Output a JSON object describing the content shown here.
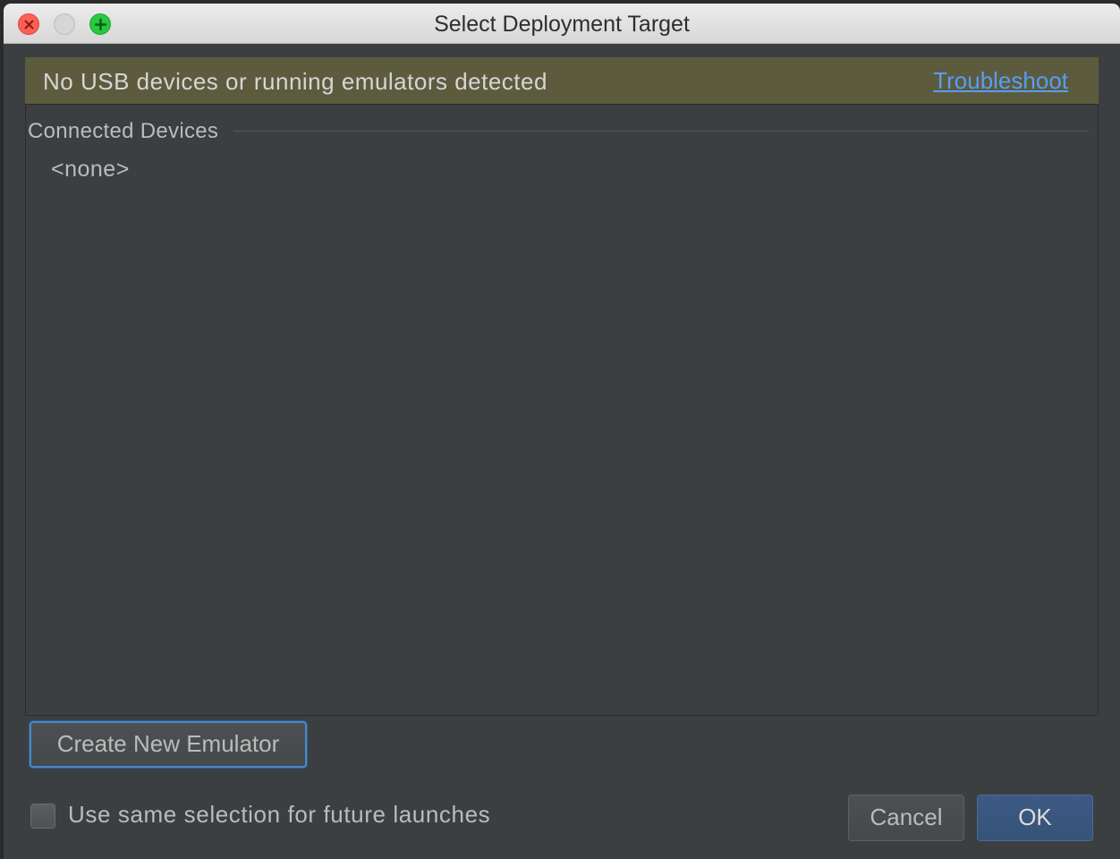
{
  "window": {
    "title": "Select Deployment Target"
  },
  "banner": {
    "message": "No USB devices or running emulators detected",
    "link_label": "Troubleshoot"
  },
  "devices": {
    "section_label": "Connected Devices",
    "empty_label": "<none>"
  },
  "actions": {
    "create_emulator_label": "Create New Emulator",
    "checkbox_label": "Use same selection for future launches",
    "checkbox_checked": false,
    "cancel_label": "Cancel",
    "ok_label": "OK"
  },
  "colors": {
    "dialog_bg": "#3c3f41",
    "banner_bg": "#5c5b3e",
    "link": "#589df6",
    "focus_ring": "#4a88c7",
    "default_button": "#365378"
  },
  "icons": [
    "close-icon",
    "minimize-icon",
    "maximize-icon"
  ]
}
